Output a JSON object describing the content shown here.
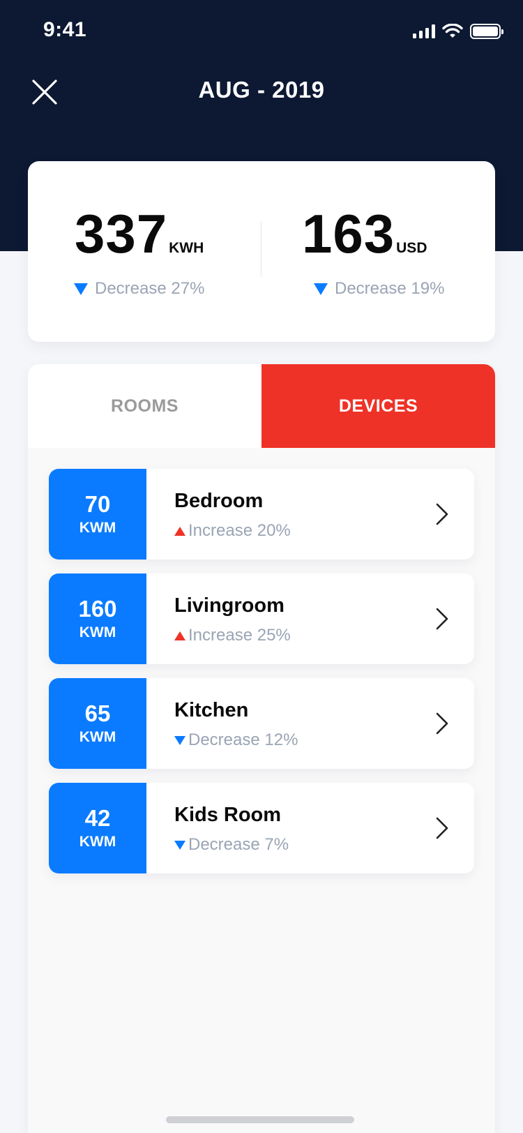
{
  "status_bar": {
    "time": "9:41"
  },
  "header": {
    "title": "AUG - 2019"
  },
  "summary": {
    "energy": {
      "value": "337",
      "unit": "KWH",
      "change": "Decrease 27%",
      "direction": "down"
    },
    "cost": {
      "value": "163",
      "unit": "USD",
      "change": "Decrease 19%",
      "direction": "down"
    }
  },
  "tabs": [
    {
      "label": "ROOMS",
      "active": false
    },
    {
      "label": "DEVICES",
      "active": true
    }
  ],
  "rooms": [
    {
      "value": "70",
      "unit": "KWM",
      "name": "Bedroom",
      "change": "Increase 20%",
      "direction": "up"
    },
    {
      "value": "160",
      "unit": "KWM",
      "name": "Livingroom",
      "change": "Increase 25%",
      "direction": "up"
    },
    {
      "value": "65",
      "unit": "KWM",
      "name": "Kitchen",
      "change": "Decrease 12%",
      "direction": "down"
    },
    {
      "value": "42",
      "unit": "KWM",
      "name": "Kids Room",
      "change": "Decrease 7%",
      "direction": "down"
    }
  ],
  "colors": {
    "header_bg": "#0d1933",
    "accent_blue": "#0a7bff",
    "accent_red": "#ef3227"
  },
  "icons": {
    "close": "close-icon",
    "chevron": "chevron-right-icon",
    "increase": "triangle-up-icon",
    "decrease": "triangle-down-icon"
  }
}
